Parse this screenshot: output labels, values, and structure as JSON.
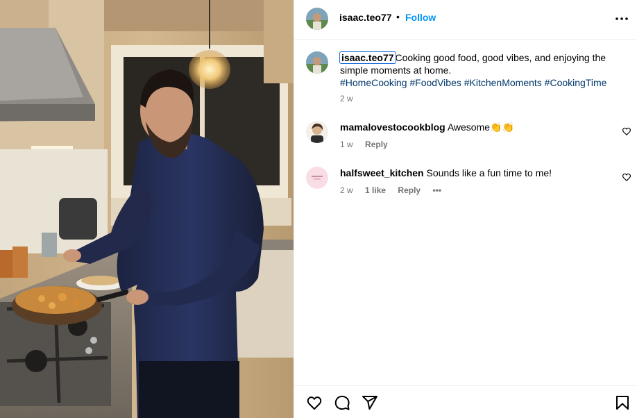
{
  "post": {
    "username": "isaac.teo77",
    "separator": "•",
    "follow_label": "Follow",
    "more_icon": "more-horizontal-icon"
  },
  "caption": {
    "username": "isaac.teo77",
    "text": "Cooking good food, good vibes, and enjoying the simple moments at home.",
    "hashtags": "#HomeCooking #FoodVibes #KitchenMoments #CookingTime",
    "time": "2 w"
  },
  "comments": [
    {
      "username": "mamalovestocookblog",
      "text": "Awesome👏👏",
      "time": "1 w",
      "reply_label": "Reply"
    },
    {
      "username": "halfsweet_kitchen",
      "text": "Sounds like a fun time to me!",
      "time": "2 w",
      "likes": "1 like",
      "reply_label": "Reply",
      "more_label": "•••"
    }
  ],
  "actions": {
    "like_icon": "heart-icon",
    "comment_icon": "comment-icon",
    "share_icon": "share-icon",
    "save_icon": "bookmark-icon"
  },
  "colors": {
    "link_blue": "#0095f6",
    "hashtag": "#00376b",
    "meta_gray": "#737373"
  }
}
